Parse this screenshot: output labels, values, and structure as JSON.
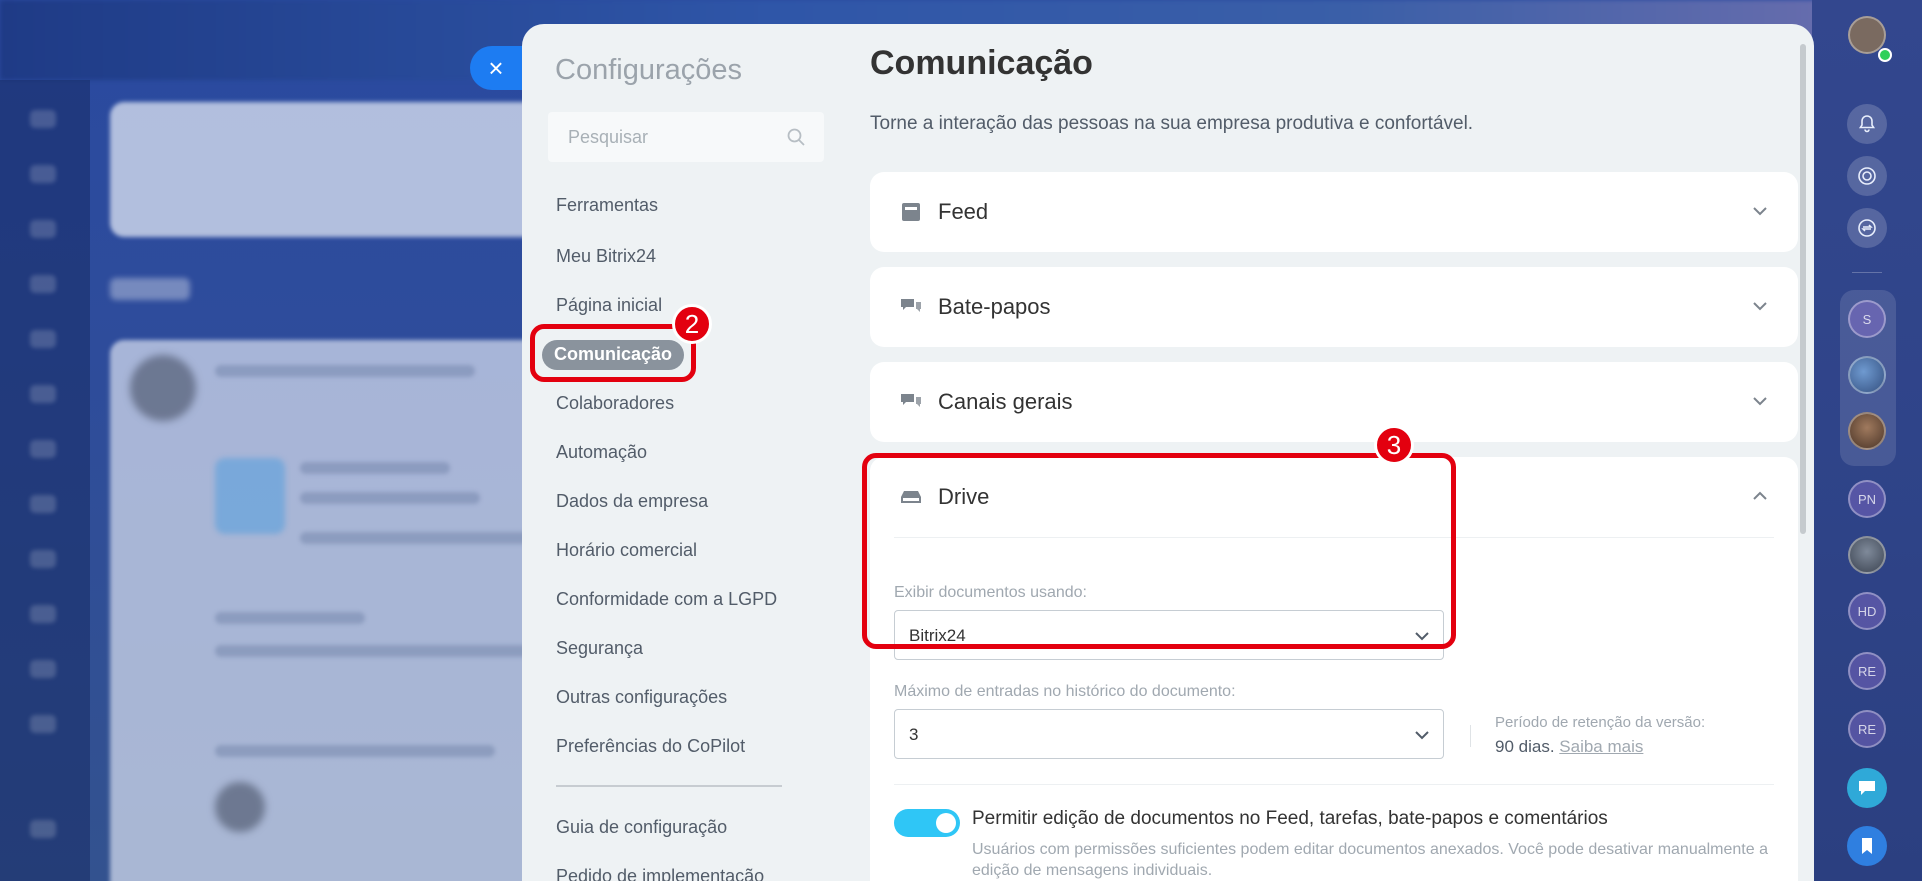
{
  "close_button": {
    "glyph": "×"
  },
  "settings": {
    "title": "Configurações",
    "search_placeholder": "Pesquisar",
    "nav": [
      {
        "label": "Ferramentas"
      },
      {
        "label": "Meu Bitrix24"
      },
      {
        "label": "Página inicial"
      },
      {
        "label": "Comunicação",
        "active": true
      },
      {
        "label": "Colaboradores"
      },
      {
        "label": "Automação"
      },
      {
        "label": "Dados da empresa"
      },
      {
        "label": "Horário comercial"
      },
      {
        "label": "Conformidade com a LGPD"
      },
      {
        "label": "Segurança"
      },
      {
        "label": "Outras configurações"
      },
      {
        "label": "Preferências do CoPilot"
      }
    ],
    "nav_secondary": [
      {
        "label": "Guia de configuração"
      },
      {
        "label": "Pedido de implementação"
      }
    ]
  },
  "page": {
    "title": "Comunicação",
    "description": "Torne a interação das pessoas na sua empresa produtiva e confortável."
  },
  "sections": [
    {
      "label": "Feed",
      "icon": "feed-icon",
      "expanded": false
    },
    {
      "label": "Bate-papos",
      "icon": "chat-icon",
      "expanded": false
    },
    {
      "label": "Canais gerais",
      "icon": "channels-icon",
      "expanded": false
    },
    {
      "label": "Drive",
      "icon": "drive-icon",
      "expanded": true
    }
  ],
  "drive": {
    "view_label": "Exibir documentos usando:",
    "view_value": "Bitrix24",
    "history_label": "Máximo de entradas no histórico do documento:",
    "history_value": "3",
    "retention_label": "Período de retenção da versão:",
    "retention_value": "90 dias.",
    "retention_link": "Saiba mais",
    "edit_toggle_on": true,
    "edit_title": "Permitir edição de documentos no Feed, tarefas, bate-papos e comentários",
    "edit_desc_line1": "Usuários com permissões suficientes podem editar documentos anexados. Você pode desativar manualmente a",
    "edit_desc_line2": "edição de mensagens individuais."
  },
  "callouts": {
    "two": "2",
    "three": "3"
  },
  "right_strip": {
    "avatars": [
      "S",
      "PN",
      "HD",
      "RE",
      "RE"
    ]
  },
  "colors": {
    "accent": "#2fc6f6",
    "callout": "#e3000f",
    "active_nav": "#8a939d",
    "close_button": "#1d7cf2"
  }
}
